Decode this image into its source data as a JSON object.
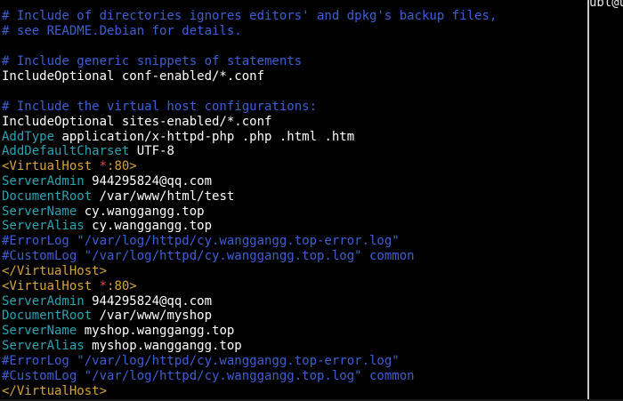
{
  "colors": {
    "background": "#000000",
    "comment": "#3d5fd6",
    "plain_text": "#ffffff",
    "directive": "#2aa3b3",
    "vhost_tag": "#d9a33a",
    "wildcard_star": "#e0464a",
    "pane_divider": "#c8c8c8"
  },
  "editor": {
    "lines": [
      {
        "kind": "comment",
        "text": "# Include of directories ignores editors' and dpkg's backup files,"
      },
      {
        "kind": "comment",
        "text": "# see README.Debian for details."
      },
      {
        "kind": "blank",
        "text": ""
      },
      {
        "kind": "comment",
        "text": "# Include generic snippets of statements"
      },
      {
        "kind": "plain",
        "text": "IncludeOptional conf-enabled/*.conf"
      },
      {
        "kind": "blank",
        "text": ""
      },
      {
        "kind": "comment",
        "text": "# Include the virtual host configurations:"
      },
      {
        "kind": "plain",
        "text": "IncludeOptional sites-enabled/*.conf"
      },
      {
        "kind": "directive",
        "directive": "AddType",
        "value": " application/x-httpd-php .php .html .htm"
      },
      {
        "kind": "directive",
        "directive": "AddDefaultCharset",
        "value": " UTF-8"
      },
      {
        "kind": "vhost_open",
        "open": "<VirtualHost ",
        "star": "*",
        "port": ":80>"
      },
      {
        "kind": "directive",
        "directive": "ServerAdmin",
        "value": " 944295824@qq.com"
      },
      {
        "kind": "directive",
        "directive": "DocumentRoot",
        "value": " /var/www/html/test"
      },
      {
        "kind": "directive",
        "directive": "ServerName",
        "value": " cy.wanggangg.top"
      },
      {
        "kind": "directive",
        "directive": "ServerAlias",
        "value": " cy.wanggangg.top"
      },
      {
        "kind": "comment",
        "text": "#ErrorLog \"/var/log/httpd/cy.wanggangg.top-error.log\""
      },
      {
        "kind": "comment",
        "text": "#CustomLog \"/var/log/httpd/cy.wanggangg.top.log\" common"
      },
      {
        "kind": "vhost_close",
        "text": "</VirtualHost>"
      },
      {
        "kind": "vhost_open",
        "open": "<VirtualHost ",
        "star": "*",
        "port": ":80>"
      },
      {
        "kind": "directive",
        "directive": "ServerAdmin",
        "value": " 944295824@qq.com"
      },
      {
        "kind": "directive",
        "directive": "DocumentRoot",
        "value": " /var/www/myshop"
      },
      {
        "kind": "directive",
        "directive": "ServerName",
        "value": " myshop.wanggangg.top"
      },
      {
        "kind": "directive",
        "directive": "ServerAlias",
        "value": " myshop.wanggangg.top"
      },
      {
        "kind": "comment",
        "text": "#ErrorLog \"/var/log/httpd/cy.wanggangg.top-error.log\""
      },
      {
        "kind": "comment",
        "text": "#CustomLog \"/var/log/httpd/cy.wanggangg.top.log\" common"
      },
      {
        "kind": "vhost_close",
        "text": "</VirtualHost>"
      }
    ]
  },
  "side_pane": {
    "prompt_fragment": "ubt@u"
  }
}
